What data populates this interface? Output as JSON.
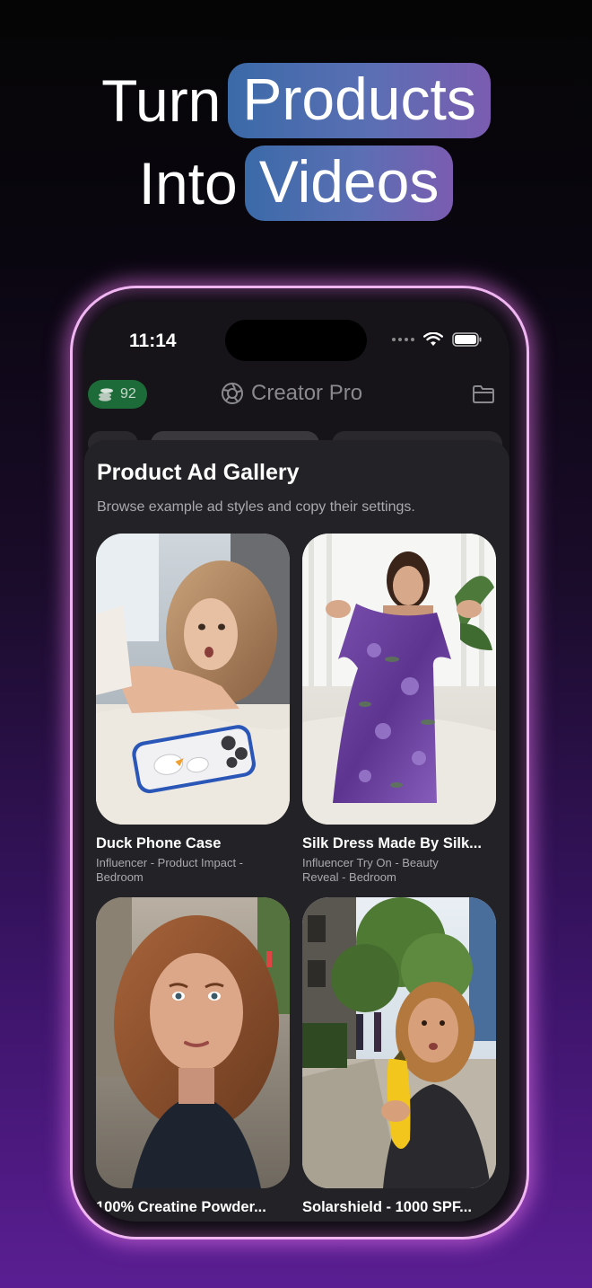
{
  "headline": {
    "line1_plain": "Turn",
    "line1_highlight": "Products",
    "line2_plain": "Into",
    "line2_highlight": "Videos"
  },
  "status_bar": {
    "time": "11:14"
  },
  "header": {
    "credits": "92",
    "app_title": "Creator Pro"
  },
  "gallery": {
    "title": "Product Ad Gallery",
    "subtitle": "Browse example ad styles and copy their settings.",
    "items": [
      {
        "title": "Duck Phone Case",
        "meta_line1": "Influencer - Product Impact -",
        "meta_line2": "Bedroom"
      },
      {
        "title": "Silk Dress Made By Silk...",
        "meta_line1": "Influencer Try On - Beauty",
        "meta_line2": "Reveal - Bedroom"
      },
      {
        "title": "100% Creatine Powder...",
        "meta_line1": "",
        "meta_line2": ""
      },
      {
        "title": "Solarshield - 1000 SPF...",
        "meta_line1": "",
        "meta_line2": ""
      }
    ]
  },
  "colors": {
    "credits_bg": "#1d6b38",
    "glow": "#f0b6f2",
    "accent_pill": "#5b6fb4"
  },
  "icons": [
    "coins-icon",
    "aperture-icon",
    "folder-icon",
    "wifi-icon",
    "battery-icon"
  ]
}
